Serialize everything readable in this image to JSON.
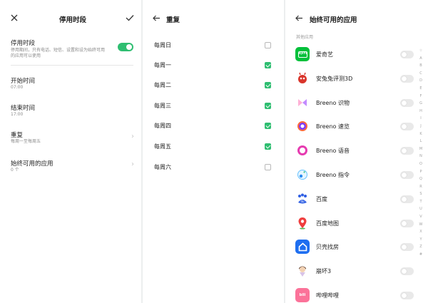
{
  "colors": {
    "accent": "#2fbe71",
    "toggle_off": "#e9e9e9"
  },
  "panel1": {
    "close_icon": "close-icon",
    "title": "停用时段",
    "confirm_icon": "check-icon",
    "schedule_toggle": {
      "title": "停用时段",
      "desc_line1": "停用期间，只有电话、短信、设置和设为始终可用",
      "desc_line2": "的应用可以使用",
      "on": true
    },
    "start": {
      "title": "开始时间",
      "value": "07:00"
    },
    "end": {
      "title": "结束时间",
      "value": "17:00"
    },
    "repeat": {
      "title": "重复",
      "value": "每周一至每周五"
    },
    "always_apps": {
      "title": "始终可用的应用",
      "value": "0 个"
    }
  },
  "panel2": {
    "back_icon": "arrow-left-icon",
    "title": "重复",
    "days": [
      {
        "label": "每周日",
        "checked": false
      },
      {
        "label": "每周一",
        "checked": true
      },
      {
        "label": "每周二",
        "checked": true
      },
      {
        "label": "每周三",
        "checked": true
      },
      {
        "label": "每周四",
        "checked": true
      },
      {
        "label": "每周五",
        "checked": true
      },
      {
        "label": "每周六",
        "checked": false
      }
    ]
  },
  "panel3": {
    "back_icon": "arrow-left-icon",
    "title": "始终可用的应用",
    "section": "其他应用",
    "apps": [
      {
        "name": "爱奇艺",
        "icon": "iqiyi-icon",
        "enabled": false
      },
      {
        "name": "安兔兔评测3D",
        "icon": "antutu-icon",
        "enabled": false
      },
      {
        "name": "Breeno 识物",
        "icon": "breeno-recognize-icon",
        "enabled": false
      },
      {
        "name": "Breeno 速览",
        "icon": "breeno-glance-icon",
        "enabled": false
      },
      {
        "name": "Breeno 语音",
        "icon": "breeno-voice-icon",
        "enabled": false
      },
      {
        "name": "Breeno 指令",
        "icon": "breeno-command-icon",
        "enabled": false
      },
      {
        "name": "百度",
        "icon": "baidu-icon",
        "enabled": false
      },
      {
        "name": "百度地图",
        "icon": "baidu-map-icon",
        "enabled": false
      },
      {
        "name": "贝壳找房",
        "icon": "beike-icon",
        "enabled": false
      },
      {
        "name": "崩坏3",
        "icon": "honkai-icon",
        "enabled": false
      },
      {
        "name": "哔哩哔哩",
        "icon": "bilibili-icon",
        "enabled": false
      }
    ],
    "index_letters": [
      "☆",
      "A",
      "B",
      "C",
      "D",
      "E",
      "F",
      "G",
      "H",
      "I",
      "J",
      "K",
      "L",
      "M",
      "N",
      "O",
      "P",
      "Q",
      "R",
      "S",
      "T",
      "U",
      "V",
      "W",
      "X",
      "Y",
      "Z",
      "#"
    ]
  }
}
